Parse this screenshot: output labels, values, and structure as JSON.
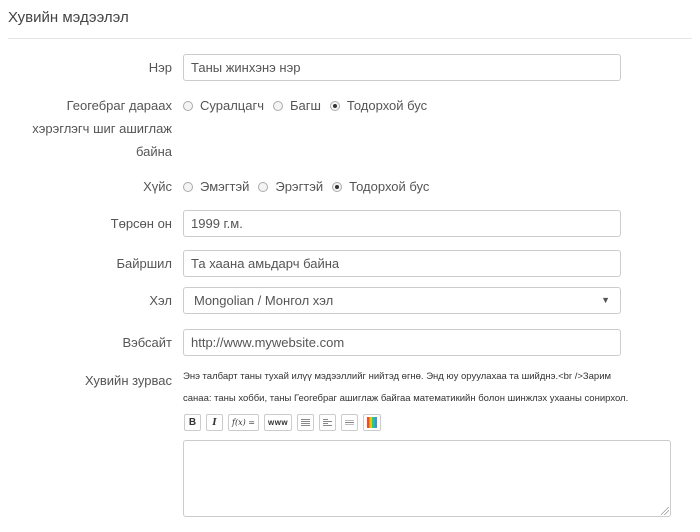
{
  "section": {
    "title": "Хувийн мэдээлэл"
  },
  "name": {
    "label": "Нэр",
    "placeholder": "Таны жинхэнэ нэр"
  },
  "role": {
    "label_lines": [
      "Геогебраг дараах",
      "хэрэглэгч шиг ашиглаж",
      "байна"
    ],
    "options": [
      "Суралцагч",
      "Багш",
      "Тодорхой бус"
    ],
    "selected": "Тодорхой бус"
  },
  "gender": {
    "label": "Хүйс",
    "options": [
      "Эмэгтэй",
      "Эрэгтэй",
      "Тодорхой бус"
    ],
    "selected": "Тодорхой бус"
  },
  "birth_year": {
    "label": "Төрсөн он",
    "placeholder": "1999 г.м."
  },
  "location": {
    "label": "Байршил",
    "placeholder": "Та хаана амьдарч байна"
  },
  "language": {
    "label": "Хэл",
    "value": "Mongolian / Монгол хэл",
    "arrow": "▼"
  },
  "website": {
    "label": "Вэбсайт",
    "placeholder": "http://www.mywebsite.com"
  },
  "bio": {
    "label": "Хувийн зурвас",
    "hint_line1": "Энэ талбарт таны тухай илүү мэдээллийг нийтэд өгнө. Энд юу оруулахаа та шийднэ.<br />Зарим",
    "hint_line2": "санаа: таны хобби, таны Геогебраг ашиглаж байгаа математикийн болон шинжлэх ухааны сонирхол.",
    "toolbar": {
      "bold": "B",
      "italic": "I",
      "formula": "f(x) =",
      "link": "www",
      "icons": [
        "bold-icon",
        "italic-icon",
        "formula-icon",
        "link-icon",
        "bulleted-list-icon",
        "numbered-list-icon",
        "horizontal-rule-icon",
        "color-icon"
      ]
    },
    "value": ""
  }
}
